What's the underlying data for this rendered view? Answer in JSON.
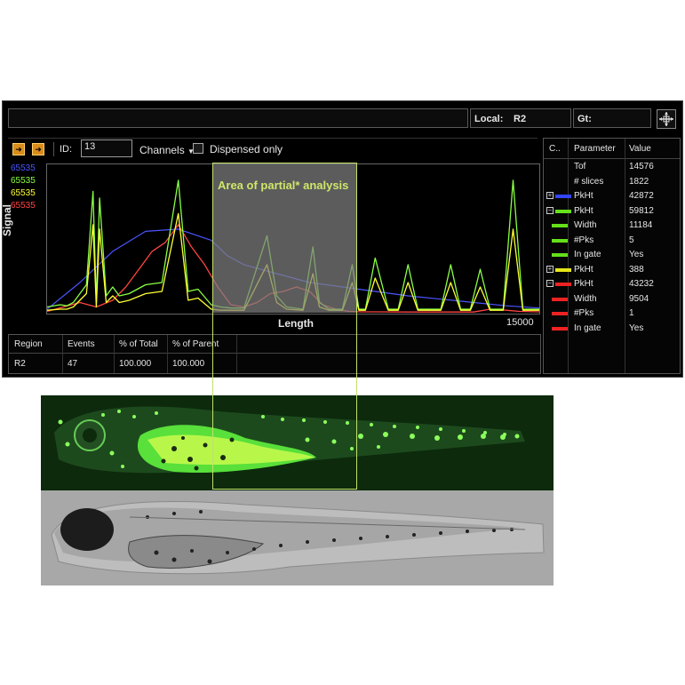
{
  "header": {
    "left_field": "",
    "local_label": "Local:",
    "local_value": "R2",
    "gt_label": "Gt:"
  },
  "toolbar": {
    "id_label": "ID:",
    "id_value": "13",
    "channels_label": "Channels",
    "dispensed_label": "Dispensed only"
  },
  "legend": {
    "values": [
      "65535",
      "65535",
      "65535",
      "65535"
    ],
    "colors": [
      "#4a55ff",
      "#88ff44",
      "#ffff33",
      "#ff4444"
    ]
  },
  "plot": {
    "ylabel": "Signal",
    "xlabel": "Length",
    "xmax_label": "15000"
  },
  "annotation": {
    "text": "Area of partial* analysis"
  },
  "stats": {
    "headers": [
      "Region",
      "Events",
      "% of Total",
      "% of Parent"
    ],
    "row": [
      "R2",
      "47",
      "100.000",
      "100.000"
    ]
  },
  "params": {
    "headers": [
      "C..",
      "Parameter",
      "Value"
    ],
    "rows": [
      {
        "expander": "",
        "color": "",
        "name": "Tof",
        "value": "14576"
      },
      {
        "expander": "",
        "color": "",
        "name": "# slices",
        "value": "1822"
      },
      {
        "expander": "+",
        "color": "#3345ff",
        "name": "PkHt",
        "value": "42872"
      },
      {
        "expander": "−",
        "color": "#66e01a",
        "name": "PkHt",
        "value": "59812"
      },
      {
        "expander": "",
        "color": "#66e01a",
        "name": "Width",
        "value": "11184"
      },
      {
        "expander": "",
        "color": "#66e01a",
        "name": "#Pks",
        "value": "5"
      },
      {
        "expander": "",
        "color": "#66e01a",
        "name": "In gate",
        "value": "Yes"
      },
      {
        "expander": "+",
        "color": "#e6e61a",
        "name": "PkHt",
        "value": "388"
      },
      {
        "expander": "−",
        "color": "#ee2222",
        "name": "PkHt",
        "value": "43232"
      },
      {
        "expander": "",
        "color": "#ee2222",
        "name": "Width",
        "value": "9504"
      },
      {
        "expander": "",
        "color": "#ee2222",
        "name": "#Pks",
        "value": "1"
      },
      {
        "expander": "",
        "color": "#ee2222",
        "name": "In gate",
        "value": "Yes"
      }
    ]
  },
  "chart_data": {
    "type": "line",
    "xlabel": "Length",
    "ylabel": "Signal",
    "x_range": [
      0,
      15000
    ],
    "y_range": [
      0,
      65535
    ],
    "series": [
      {
        "color": "#4a55ff",
        "x": [
          0,
          1000,
          2000,
          3000,
          4000,
          5000,
          5500,
          6000,
          7000,
          8000,
          9000,
          10000,
          11000,
          12000,
          13000,
          14000,
          15000
        ],
        "y": [
          2000,
          14000,
          28000,
          37000,
          38000,
          33000,
          26000,
          22000,
          18000,
          14000,
          12000,
          10000,
          8000,
          6500,
          5000,
          3500,
          2500
        ]
      },
      {
        "color": "#88ff44",
        "x": [
          0,
          400,
          600,
          800,
          1200,
          1400,
          1500,
          1600,
          1800,
          2000,
          2200,
          2500,
          3000,
          3500,
          4000,
          4300,
          4600,
          5000,
          5300,
          5600,
          6000,
          6700,
          7000,
          7300,
          7800,
          8100,
          8300,
          8600,
          9000,
          9300,
          9500,
          9700,
          10000,
          10400,
          10700,
          11000,
          11300,
          11600,
          12000,
          12300,
          12600,
          12900,
          13200,
          13500,
          13900,
          14200,
          14500,
          15000
        ],
        "y": [
          3000,
          4000,
          3500,
          5000,
          13000,
          55000,
          5000,
          52000,
          8000,
          12000,
          8000,
          9000,
          13000,
          14000,
          60000,
          10000,
          11000,
          4000,
          3000,
          2500,
          2500,
          35000,
          8000,
          3000,
          2000,
          30000,
          5000,
          2000,
          2000,
          22000,
          2000,
          2000,
          25000,
          2000,
          2000,
          22000,
          2000,
          2000,
          2000,
          22000,
          2000,
          2000,
          20000,
          2000,
          2000,
          60000,
          2000,
          2000
        ]
      },
      {
        "color": "#ffff33",
        "x": [
          0,
          400,
          600,
          800,
          1200,
          1400,
          1500,
          1600,
          1800,
          2000,
          2200,
          2500,
          3000,
          3500,
          4000,
          4300,
          4600,
          5000,
          5300,
          5600,
          6000,
          6700,
          7000,
          7300,
          7800,
          8100,
          8300,
          8600,
          9000,
          9300,
          9500,
          9700,
          10000,
          10400,
          10700,
          11000,
          11300,
          11600,
          12000,
          12300,
          12600,
          12900,
          13200,
          13500,
          13900,
          14200,
          14500,
          15000
        ],
        "y": [
          1500,
          2000,
          2000,
          3000,
          9000,
          40000,
          3000,
          38000,
          5000,
          8000,
          5000,
          6000,
          9000,
          10000,
          45000,
          6000,
          7000,
          2000,
          1500,
          1500,
          1500,
          22000,
          5000,
          2000,
          1500,
          18000,
          3000,
          1500,
          1500,
          14000,
          1500,
          1500,
          16000,
          1500,
          1500,
          14000,
          1500,
          1500,
          1500,
          14000,
          1500,
          1500,
          12000,
          1500,
          1500,
          38000,
          1500,
          1500
        ]
      },
      {
        "color": "#ff4444",
        "x": [
          0,
          500,
          1000,
          1500,
          2000,
          2400,
          2800,
          3200,
          3600,
          4000,
          4400,
          4800,
          5200,
          5600,
          6000,
          6400,
          6800,
          7200,
          7600,
          8000,
          8400,
          8800,
          9200,
          9600,
          10000,
          11000,
          12000,
          13000,
          13500,
          14000,
          14400,
          15000
        ],
        "y": [
          1000,
          3000,
          5000,
          3000,
          6000,
          12000,
          20000,
          28000,
          32000,
          40000,
          30000,
          22000,
          12000,
          4000,
          3000,
          5000,
          9000,
          10000,
          12000,
          10000,
          4000,
          2000,
          1000,
          800,
          800,
          700,
          700,
          700,
          2000,
          1500,
          1000,
          800
        ]
      }
    ]
  }
}
